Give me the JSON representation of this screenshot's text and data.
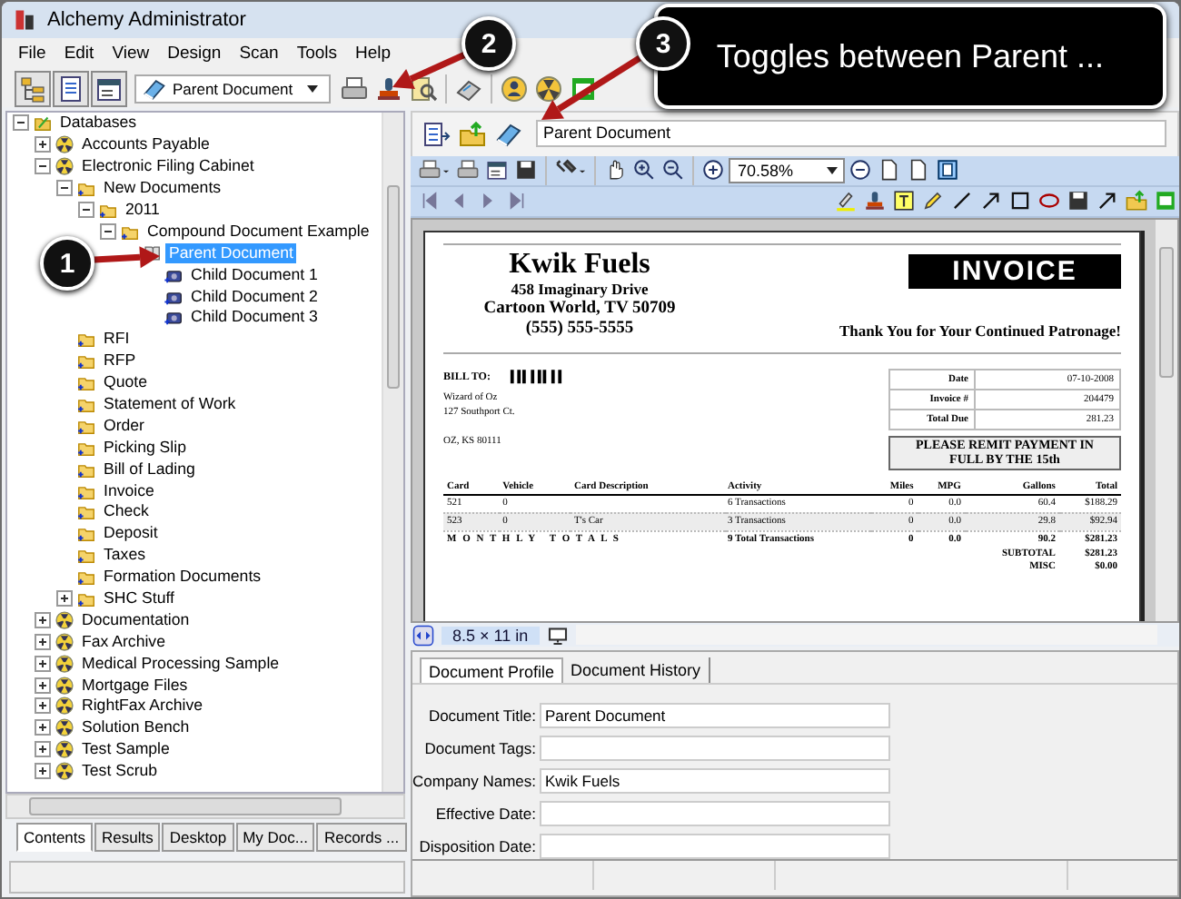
{
  "window": {
    "title": "Alchemy Administrator"
  },
  "menu": [
    "File",
    "Edit",
    "View",
    "Design",
    "Scan",
    "Tools",
    "Help"
  ],
  "toolbar": {
    "document_select": "Parent Document"
  },
  "tree": [
    {
      "label": "Databases",
      "kind": "root",
      "expanded": true,
      "selected": false,
      "children": [
        {
          "label": "Accounts Payable",
          "kind": "database",
          "expanded": false,
          "selected": false
        },
        {
          "label": "Electronic Filing Cabinet",
          "kind": "database",
          "expanded": true,
          "selected": false,
          "children": [
            {
              "label": "New Documents",
              "kind": "folder",
              "expanded": true,
              "selected": false,
              "children": [
                {
                  "label": "2011",
                  "kind": "folder",
                  "expanded": true,
                  "selected": false,
                  "children": [
                    {
                      "label": "Compound Document Example",
                      "kind": "folder",
                      "expanded": true,
                      "selected": false,
                      "children": [
                        {
                          "label": "Parent Document",
                          "kind": "parent-document",
                          "selected": true,
                          "children": [
                            {
                              "label": "Child Document 1",
                              "kind": "child-document",
                              "selected": false
                            },
                            {
                              "label": "Child Document 2",
                              "kind": "child-document",
                              "selected": false
                            },
                            {
                              "label": "Child Document 3",
                              "kind": "child-document",
                              "selected": false
                            }
                          ]
                        }
                      ]
                    }
                  ]
                }
              ]
            },
            {
              "label": "RFI",
              "kind": "folder",
              "selected": false
            },
            {
              "label": "RFP",
              "kind": "folder",
              "selected": false
            },
            {
              "label": "Quote",
              "kind": "folder",
              "selected": false
            },
            {
              "label": "Statement of Work",
              "kind": "folder",
              "selected": false
            },
            {
              "label": "Order",
              "kind": "folder",
              "selected": false
            },
            {
              "label": "Picking Slip",
              "kind": "folder",
              "selected": false
            },
            {
              "label": "Bill of Lading",
              "kind": "folder",
              "selected": false
            },
            {
              "label": "Invoice",
              "kind": "folder",
              "selected": false
            },
            {
              "label": "Check",
              "kind": "folder",
              "selected": false
            },
            {
              "label": "Deposit",
              "kind": "folder",
              "selected": false
            },
            {
              "label": "Taxes",
              "kind": "folder",
              "selected": false
            },
            {
              "label": "Formation Documents",
              "kind": "folder",
              "selected": false
            },
            {
              "label": "SHC Stuff",
              "kind": "folder",
              "expanded": false,
              "selected": false
            }
          ]
        },
        {
          "label": "Documentation",
          "kind": "database",
          "expanded": false,
          "selected": false
        },
        {
          "label": "Fax Archive",
          "kind": "database",
          "expanded": false,
          "selected": false
        },
        {
          "label": "Medical Processing Sample",
          "kind": "database",
          "expanded": false,
          "selected": false
        },
        {
          "label": "Mortgage Files",
          "kind": "database",
          "expanded": false,
          "selected": false
        },
        {
          "label": "RightFax Archive",
          "kind": "database",
          "expanded": false,
          "selected": false
        },
        {
          "label": "Solution Bench",
          "kind": "database",
          "expanded": false,
          "selected": false
        },
        {
          "label": "Test Sample",
          "kind": "database",
          "expanded": false,
          "selected": false
        },
        {
          "label": "Test Scrub",
          "kind": "database",
          "expanded": false,
          "selected": false
        }
      ]
    }
  ],
  "left_tabs": [
    {
      "label": "Contents",
      "selected": true
    },
    {
      "label": "Results",
      "selected": false
    },
    {
      "label": "Desktop",
      "selected": false
    },
    {
      "label": "My Doc...",
      "selected": false
    },
    {
      "label": "Records ...",
      "selected": false
    }
  ],
  "document_bar": {
    "title_field": "Parent Document"
  },
  "viewer": {
    "zoom": "70.58%",
    "page_size": "8.5 × 11 in"
  },
  "invoice": {
    "company": "Kwik Fuels",
    "address": [
      "458 Imaginary Drive",
      "Cartoon World, TV 50709",
      "(555) 555-5555"
    ],
    "heading": "INVOICE",
    "thanks": "Thank You for Your Continued Patronage!",
    "bill_to_label": "BILL TO:",
    "bill_to": [
      "Wizard of Oz",
      "127 Southport Ct."
    ],
    "bill_to_city": "OZ, KS 80111",
    "info": [
      {
        "label": "Date",
        "value": "07-10-2008"
      },
      {
        "label": "Invoice #",
        "value": "204479"
      },
      {
        "label": "Total Due",
        "value": "281.23"
      }
    ],
    "remit": "PLEASE REMIT PAYMENT IN FULL BY THE 15th",
    "columns": [
      "Card",
      "Vehicle",
      "Card Description",
      "Activity",
      "Miles",
      "MPG",
      "Gallons",
      "Total"
    ],
    "rows": [
      [
        "521",
        "0",
        "",
        "6 Transactions",
        "0",
        "0.0",
        "60.4",
        "$188.29"
      ],
      [
        "523",
        "0",
        "T's Car",
        "3 Transactions",
        "0",
        "0.0",
        "29.8",
        "$92.94"
      ]
    ],
    "totals": {
      "label": "M O N T H L Y   T O T A L S",
      "activity": "9 Total Transactions",
      "miles": "0",
      "mpg": "0.0",
      "gallons": "90.2",
      "total": "$281.23"
    },
    "summary": [
      {
        "label": "SUBTOTAL",
        "value": "$281.23"
      },
      {
        "label": "MISC",
        "value": "$0.00"
      }
    ]
  },
  "profile_tabs": [
    {
      "label": "Document Profile",
      "selected": true
    },
    {
      "label": "Document History",
      "selected": false
    }
  ],
  "profile_fields": [
    {
      "label": "Document Title:",
      "value": "Parent Document"
    },
    {
      "label": "Document Tags:"
    },
    {
      "label": "Company Names:",
      "value": "Kwik Fuels"
    },
    {
      "label": "Effective Date:"
    },
    {
      "label": "Disposition Date:"
    }
  ],
  "callouts": [
    "1",
    "2",
    "3"
  ],
  "tooltip": "Toggles between Parent ..."
}
